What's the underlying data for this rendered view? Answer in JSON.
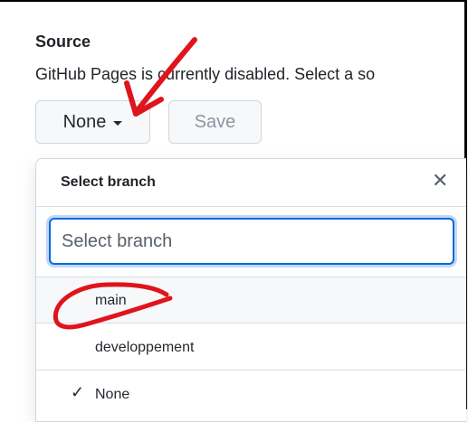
{
  "source": {
    "heading": "Source",
    "description": "GitHub Pages is currently disabled. Select a so"
  },
  "branch_button": {
    "label": "None"
  },
  "save_button": {
    "label": "Save"
  },
  "branch_menu": {
    "title": "Select branch",
    "close_icon": "close-icon",
    "filter_placeholder": "Select branch",
    "items": [
      {
        "label": "main",
        "selected": false
      },
      {
        "label": "developpement",
        "selected": false
      },
      {
        "label": "None",
        "selected": true
      }
    ]
  },
  "colors": {
    "annotation": "#e0141c",
    "focus_border": "#0969da",
    "border": "#d0d7de"
  }
}
